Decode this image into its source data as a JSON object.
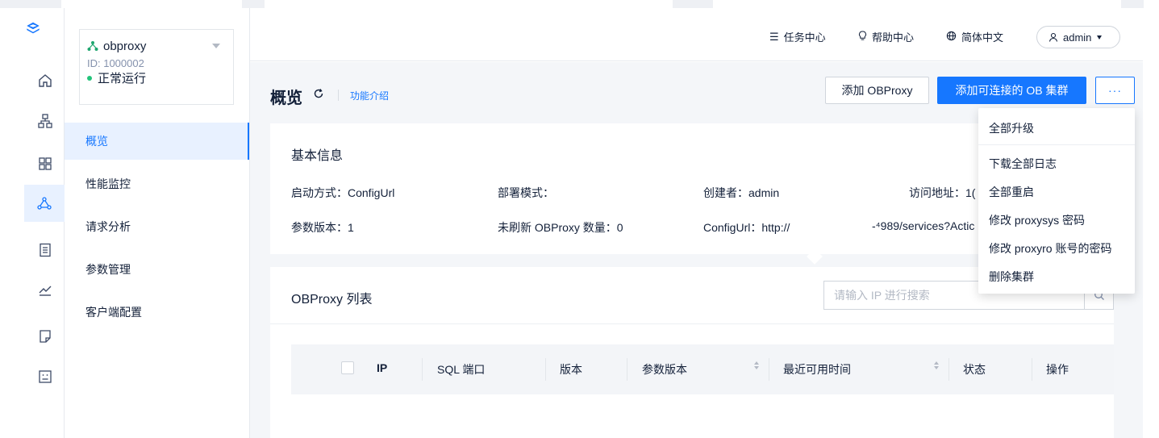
{
  "colors": {
    "accent": "#1677ff",
    "status_ok": "#22c47a",
    "text": "#132039",
    "muted": "#8592ad"
  },
  "rail": {
    "logo": "oceanbase-logo-icon",
    "icons": [
      "home-icon",
      "cluster-topology-icon",
      "grid-icon",
      "obproxy-icon",
      "document-list-icon",
      "line-chart-icon",
      "file-icon",
      "terminal-icon"
    ]
  },
  "cluster": {
    "name": "obproxy",
    "id": "ID: 1000002",
    "status": "正常运行"
  },
  "menu": {
    "items": [
      "概览",
      "性能监控",
      "请求分析",
      "参数管理",
      "客户端配置"
    ],
    "active_index": 0
  },
  "header": {
    "task_center": "任务中心",
    "help_center": "帮助中心",
    "language": "简体中文",
    "user": "admin"
  },
  "page": {
    "title": "概览",
    "intro_link": "功能介绍",
    "btn_add": "添加 OBProxy",
    "btn_add_cluster": "添加可连接的 OB 集群",
    "btn_more": "···"
  },
  "basic_info": {
    "title": "基本信息",
    "start_mode": "启动方式：ConfigUrl",
    "deploy_mode": "部署模式：",
    "creator": "创建者：admin",
    "access_addr": "访问地址：1(",
    "param_version": "参数版本：1",
    "unrefreshed": "未刷新 OBProxy 数量：0",
    "config_url": "ConfigUrl：http://",
    "config_url_tail": "-⁴989/services?Actic"
  },
  "proxy_list": {
    "title": "OBProxy 列表",
    "search_placeholder": "请输入 IP 进行搜索",
    "columns": [
      "IP",
      "SQL 端口",
      "版本",
      "参数版本",
      "最近可用时间",
      "状态",
      "操作"
    ]
  },
  "more_menu": {
    "items": [
      "全部升级",
      "下载全部日志",
      "全部重启",
      "修改 proxysys 密码",
      "修改 proxyro 账号的密码",
      "删除集群"
    ]
  }
}
